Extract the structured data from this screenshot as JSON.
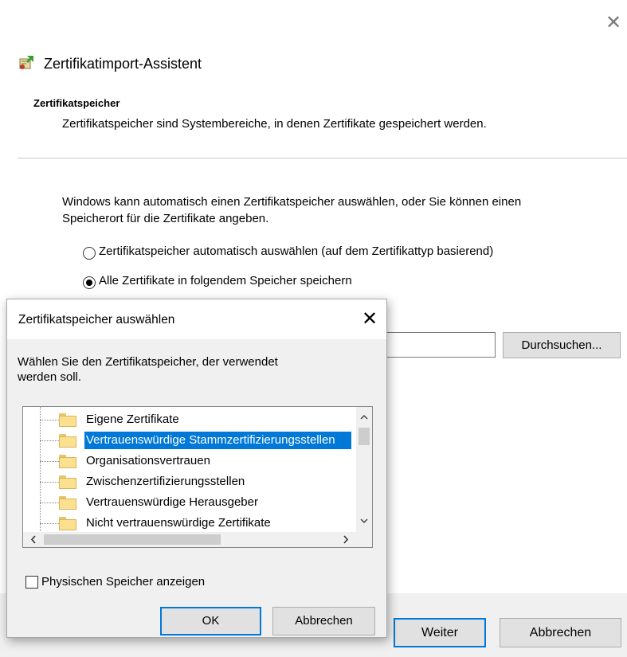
{
  "wizard": {
    "title": "Zertifikatimport-Assistent",
    "section_title": "Zertifikatspeicher",
    "section_subtitle": "Zertifikatspeicher sind Systembereiche, in denen Zertifikate gespeichert werden.",
    "description_line1": "Windows kann automatisch einen Zertifikatspeicher auswählen, oder Sie können einen",
    "description_line2": "Speicherort für die Zertifikate angeben.",
    "radio_auto_label": "Zertifikatspeicher automatisch auswählen (auf dem Zertifikattyp basierend)",
    "radio_all_label": "Alle Zertifikate in folgendem Speicher speichern",
    "selected_option": "all",
    "store_field_value": "",
    "browse_label": "Durchsuchen...",
    "next_label": "Weiter",
    "cancel_label": "Abbrechen",
    "close_glyph": "✕"
  },
  "dialog": {
    "title": "Zertifikatspeicher auswählen",
    "close_glyph": "✕",
    "prompt_line1": "Wählen Sie den Zertifikatspeicher, der verwendet",
    "prompt_line2": "werden soll.",
    "tree_items": [
      {
        "label": "Eigene Zertifikate",
        "selected": false
      },
      {
        "label": "Vertrauenswürdige Stammzertifizierungsstellen",
        "selected": true
      },
      {
        "label": "Organisationsvertrauen",
        "selected": false
      },
      {
        "label": "Zwischenzertifizierungsstellen",
        "selected": false
      },
      {
        "label": "Vertrauenswürdige Herausgeber",
        "selected": false
      },
      {
        "label": "Nicht vertrauenswürdige Zertifikate",
        "selected": false
      }
    ],
    "show_physical_label": "Physischen Speicher anzeigen",
    "show_physical_checked": false,
    "ok_label": "OK",
    "cancel_label": "Abbrechen",
    "scroll_up": "^",
    "scroll_down": "v",
    "scroll_left": "<",
    "scroll_right": ">"
  },
  "colors": {
    "accent": "#0078d7",
    "selection": "#0078d7",
    "button_face": "#e1e1e1",
    "dialog_bg": "#f0f0f0"
  },
  "icons": {
    "wizard_icon": "certificate-import-icon",
    "folder_icon": "folder-icon"
  }
}
